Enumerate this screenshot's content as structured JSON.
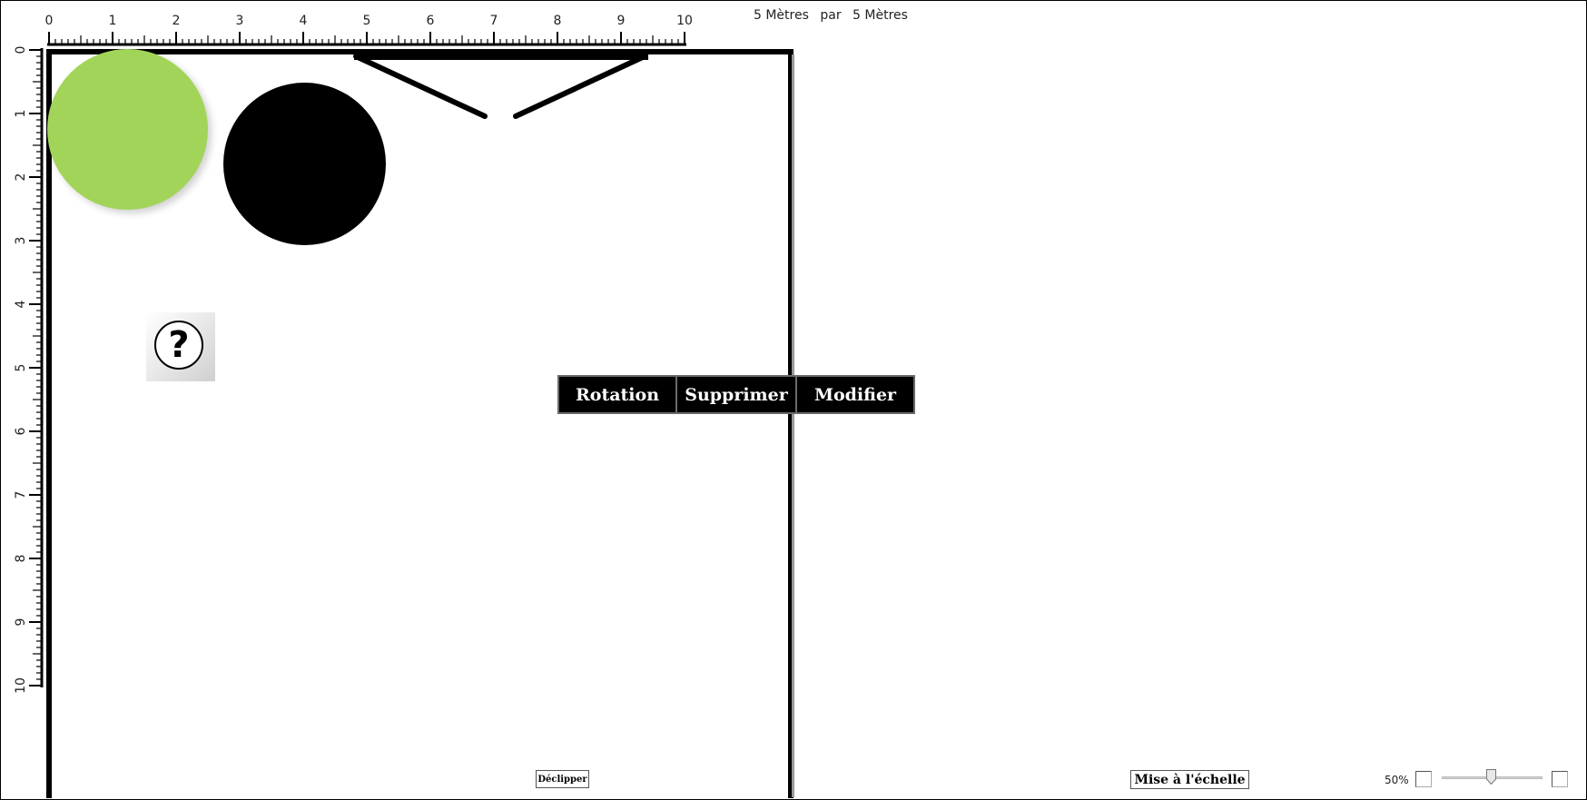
{
  "header": {
    "width_label": "5 Mètres",
    "par_label": "par",
    "height_label": "5 Mètres"
  },
  "rulers": {
    "horizontal": [
      "0",
      "1",
      "2",
      "3",
      "4",
      "5",
      "6",
      "7",
      "8",
      "9",
      "10"
    ],
    "vertical": [
      "0",
      "1",
      "2",
      "3",
      "4",
      "5",
      "6",
      "7",
      "8",
      "9",
      "10"
    ]
  },
  "objects": {
    "green_color": "#a2d45a",
    "black_color": "#000000",
    "help_icon_glyph": "?"
  },
  "context_menu": {
    "items": [
      {
        "label": "Rotation"
      },
      {
        "label": "Supprimer"
      },
      {
        "label": "Modifier"
      }
    ]
  },
  "bottom": {
    "declip_label": "Déclipper",
    "scale_label": "Mise à l'échelle",
    "zoom_value": "50%",
    "zoom_fraction": 0.5
  }
}
